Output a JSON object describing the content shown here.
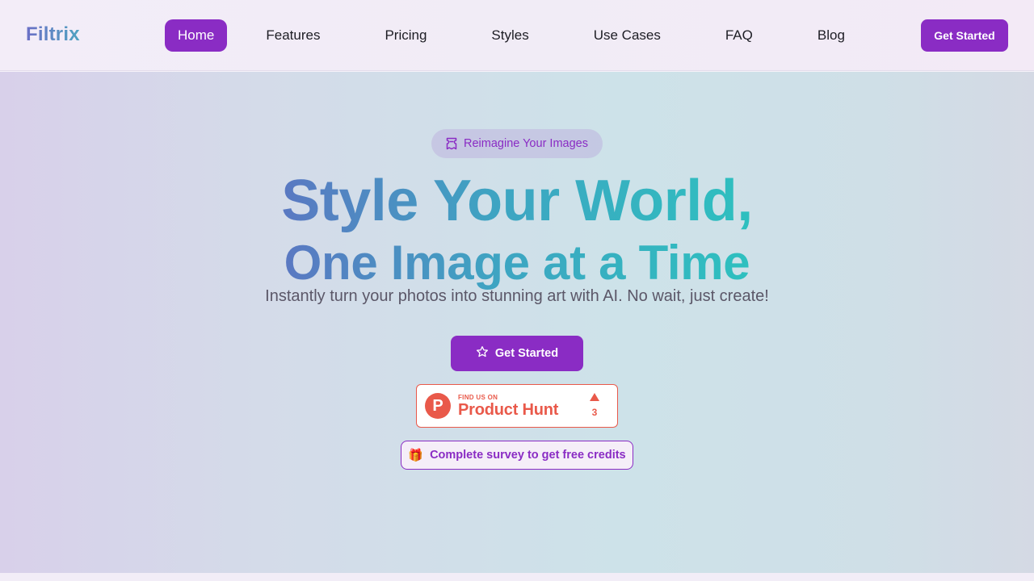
{
  "header": {
    "logo": "Filtrix",
    "nav": [
      {
        "label": "Home",
        "active": true
      },
      {
        "label": "Features",
        "active": false
      },
      {
        "label": "Pricing",
        "active": false
      },
      {
        "label": "Styles",
        "active": false
      },
      {
        "label": "Use Cases",
        "active": false
      },
      {
        "label": "FAQ",
        "active": false
      },
      {
        "label": "Blog",
        "active": false
      }
    ],
    "cta_label": "Get Started"
  },
  "hero": {
    "pill_icon": "ticket-icon",
    "pill_label": "Reimagine Your Images",
    "title_line1": "Style Your World,",
    "title_line2": "One Image at a Time",
    "subtitle": "Instantly turn your photos into stunning art with AI. No wait, just create!",
    "cta_icon": "star-icon",
    "cta_label": "Get Started",
    "product_hunt": {
      "logo_letter": "P",
      "small_text": "FIND US ON",
      "name": "Product Hunt",
      "upvotes": "3"
    },
    "survey_icon": "gift-icon",
    "survey_label": "Complete survey to get free credits"
  },
  "colors": {
    "accent": "#8a2cc4",
    "product_hunt": "#e9594a",
    "gradient_start": "#5a78c2",
    "gradient_end": "#2ec0bf"
  }
}
